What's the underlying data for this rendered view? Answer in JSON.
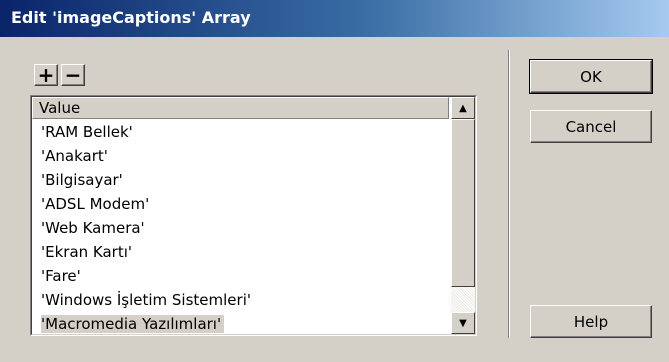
{
  "window": {
    "title": "Edit 'imageCaptions' Array"
  },
  "toolbar": {
    "add_label": "+",
    "remove_label": "−"
  },
  "list": {
    "column_header": "Value",
    "items": [
      "'RAM Bellek'",
      "'Anakart'",
      "'Bilgisayar'",
      "'ADSL Modem'",
      "'Web Kamera'",
      "'Ekran Kartı'",
      "'Fare'",
      "'Windows İşletim Sistemleri'",
      "'Macromedia Yazılımları'"
    ],
    "selected_index": 8
  },
  "buttons": {
    "ok": "OK",
    "cancel": "Cancel",
    "help": "Help"
  },
  "colors": {
    "dialog_bg": "#d4d0c8",
    "title_start": "#0a246a",
    "title_end": "#a6caf0"
  }
}
